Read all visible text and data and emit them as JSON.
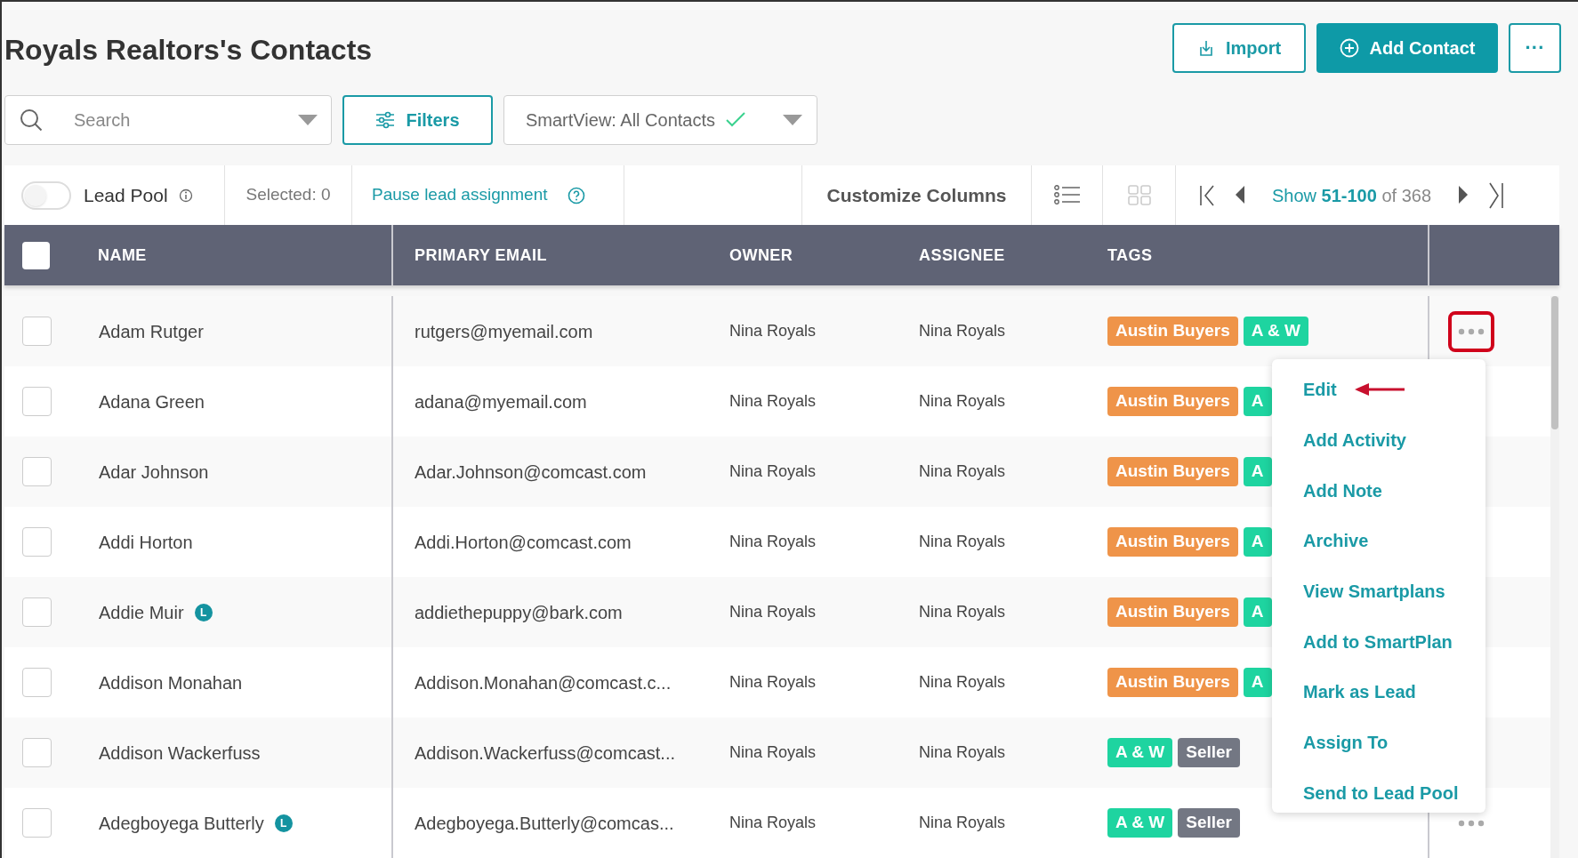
{
  "title": "Royals Realtors's Contacts",
  "header_buttons": [
    {
      "kind": "import",
      "label": "Import"
    },
    {
      "kind": "add",
      "label": "Add Contact"
    },
    {
      "kind": "more",
      "label": "···"
    }
  ],
  "search": {
    "placeholder": "Search"
  },
  "filters_button": {
    "label": "Filters"
  },
  "smartview": {
    "label": "SmartView: All Contacts",
    "applied": true
  },
  "toolbar": {
    "lead_pool": {
      "label": "Lead Pool",
      "on": false
    },
    "selected": "Selected: 0",
    "pause_link": "Pause lead assignment",
    "customize": "Customize Columns",
    "views": [
      {
        "kind": "list",
        "selected": true
      },
      {
        "kind": "grid",
        "selected": false
      }
    ],
    "pager": {
      "prefix": "Show",
      "range": "51-100",
      "total": "of 368"
    }
  },
  "table": {
    "select_all": {
      "checked": false
    },
    "columns": [
      "NAME",
      "PRIMARY EMAIL",
      "OWNER",
      "ASSIGNEE",
      "TAGS"
    ],
    "rows": [
      {
        "checked": false,
        "name": "Adam Rutger",
        "email": "rutgers@myemail.com",
        "owner": "Nina Royals",
        "assignee": "Nina Royals",
        "tags": [
          {
            "label": "Austin Buyers",
            "color": "#ef9449"
          },
          {
            "label": "A & W",
            "color": "#1ed4a0"
          }
        ],
        "actions": {
          "highlighted": true
        }
      },
      {
        "checked": false,
        "name": "Adana Green",
        "email": "adana@myemail.com",
        "owner": "Nina Royals",
        "assignee": "Nina Royals",
        "tags": [
          {
            "label": "Austin Buyers",
            "color": "#ef9449"
          },
          {
            "label": "A",
            "color": "#1ed4a0"
          }
        ]
      },
      {
        "checked": false,
        "name": "Adar Johnson",
        "email": "Adar.Johnson@comcast.com",
        "owner": "Nina Royals",
        "assignee": "Nina Royals",
        "tags": [
          {
            "label": "Austin Buyers",
            "color": "#ef9449"
          },
          {
            "label": "A",
            "color": "#1ed4a0"
          }
        ]
      },
      {
        "checked": false,
        "name": "Addi Horton",
        "email": "Addi.Horton@comcast.com",
        "owner": "Nina Royals",
        "assignee": "Nina Royals",
        "tags": [
          {
            "label": "Austin Buyers",
            "color": "#ef9449"
          },
          {
            "label": "A",
            "color": "#1ed4a0"
          }
        ]
      },
      {
        "checked": false,
        "name": "Addie Muir",
        "badge": "L",
        "email": "addiethepuppy@bark.com",
        "owner": "Nina Royals",
        "assignee": "Nina Royals",
        "tags": [
          {
            "label": "Austin Buyers",
            "color": "#ef9449"
          },
          {
            "label": "A",
            "color": "#1ed4a0"
          }
        ]
      },
      {
        "checked": false,
        "name": "Addison Monahan",
        "email": "Addison.Monahan@comcast.c...",
        "owner": "Nina Royals",
        "assignee": "Nina Royals",
        "tags": [
          {
            "label": "Austin Buyers",
            "color": "#ef9449"
          },
          {
            "label": "A",
            "color": "#1ed4a0"
          }
        ]
      },
      {
        "checked": false,
        "name": "Addison Wackerfuss",
        "email": "Addison.Wackerfuss@comcast...",
        "owner": "Nina Royals",
        "assignee": "Nina Royals",
        "tags": [
          {
            "label": "A & W",
            "color": "#1ed4a0"
          },
          {
            "label": "Seller",
            "color": "#737783"
          }
        ]
      },
      {
        "checked": false,
        "name": "Adegboyega Butterly",
        "badge": "L",
        "email": "Adegboyega.Butterly@comcas...",
        "owner": "Nina Royals",
        "assignee": "Nina Royals",
        "tags": [
          {
            "label": "A & W",
            "color": "#1ed4a0"
          },
          {
            "label": "Seller",
            "color": "#737783"
          }
        ],
        "actions": {
          "highlighted": false
        }
      }
    ]
  },
  "row_menu": {
    "items": [
      {
        "label": "Edit",
        "annotated": true
      },
      {
        "label": "Add Activity",
        "annotated": false
      },
      {
        "label": "Add Note",
        "annotated": false
      },
      {
        "label": "Archive",
        "annotated": false
      },
      {
        "label": "View Smartplans",
        "annotated": false
      },
      {
        "label": "Add to SmartPlan",
        "annotated": false
      },
      {
        "label": "Mark as Lead",
        "annotated": false
      },
      {
        "label": "Assign To",
        "annotated": false
      },
      {
        "label": "Send to Lead Pool",
        "annotated": false
      }
    ]
  }
}
